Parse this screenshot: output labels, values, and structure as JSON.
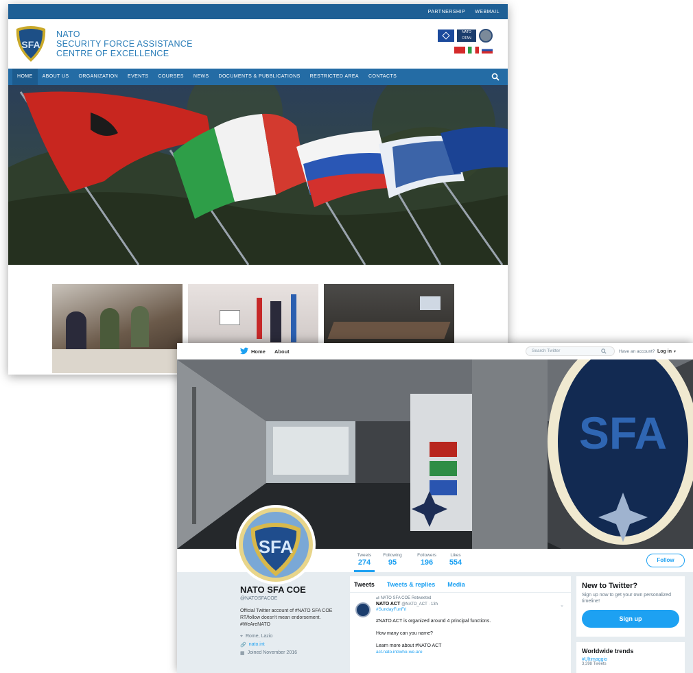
{
  "site": {
    "topbar_links": [
      "PARTNERSHIP",
      "WEBMAIL"
    ],
    "brand": {
      "line1": "NATO",
      "line2": "SECURITY FORCE ASSISTANCE",
      "line3": "CENTRE OF EXCELLENCE",
      "logo_text": "SFA"
    },
    "partners": {
      "nato_label": "NATO OTAN"
    },
    "nav": [
      "HOME",
      "ABOUT US",
      "ORGANIZATION",
      "EVENTS",
      "COURSES",
      "NEWS",
      "DOCUMENTS & PUBBLICATIONS",
      "RESTRICTED AREA",
      "CONTACTS"
    ],
    "search_icon": "magnifier-icon"
  },
  "twitter": {
    "topbar": {
      "home": "Home",
      "about": "About",
      "search_placeholder": "Search Twitter",
      "have_account": "Have an account?",
      "login": "Log in"
    },
    "banner_text": "SFA",
    "stats": [
      {
        "label": "Tweets",
        "value": "274"
      },
      {
        "label": "Following",
        "value": "95"
      },
      {
        "label": "Followers",
        "value": "196"
      },
      {
        "label": "Likes",
        "value": "554"
      }
    ],
    "follow": "Follow",
    "profile": {
      "name": "NATO SFA COE",
      "handle": "@NATOSFACOE",
      "bio": "Official Twitter account of #NATO SFA COE RT/follow doesn't mean endorsement. #WeAreNATO",
      "location": "Rome, Lazio",
      "url": "nato.int",
      "joined": "Joined November 2016"
    },
    "tabs": [
      "Tweets",
      "Tweets & replies",
      "Media"
    ],
    "tweet": {
      "retweet_note": "NATO SFA COE Retweeted",
      "author": "NATO ACT",
      "handle": "@NATO_ACT · 13h",
      "hashtag": "#SundayFunFri",
      "line1": "#NATO ACT is organized around 4 principal functions.",
      "line2": "How many can you name?",
      "line3": "Learn more about #NATO ACT",
      "link": "act.nato.int/who-we-are"
    },
    "new_to_twitter": {
      "title": "New to Twitter?",
      "desc": "Sign up now to get your own personalized timeline!",
      "button": "Sign up"
    },
    "trends": {
      "title": "Worldwide trends",
      "item": "#Ultimaggio",
      "count": "3,398 Tweets"
    }
  }
}
